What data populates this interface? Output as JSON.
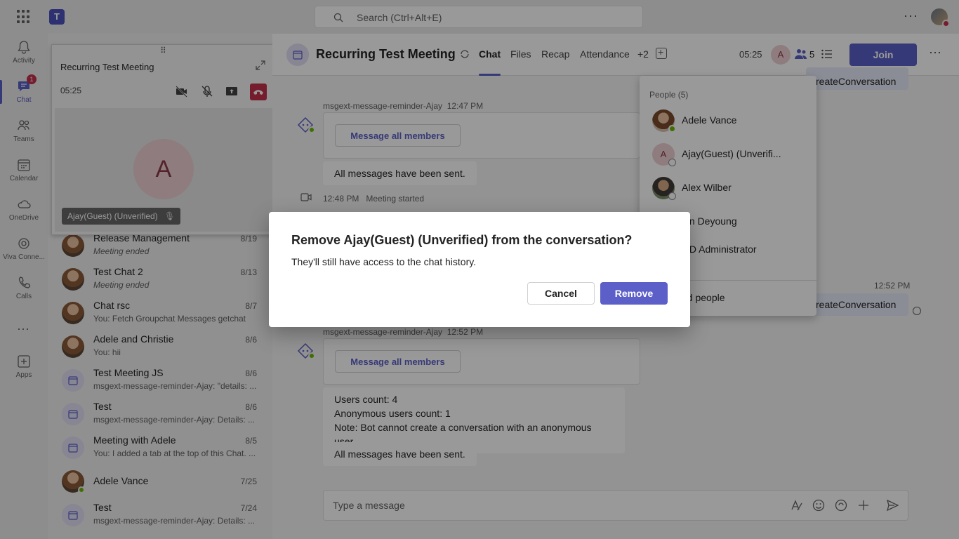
{
  "topbar": {
    "search_placeholder": "Search (Ctrl+Alt+E)",
    "app_logo": "T"
  },
  "rail": {
    "items": [
      {
        "label": "Activity",
        "icon": "bell-icon"
      },
      {
        "label": "Chat",
        "icon": "chat-icon",
        "badge": "1"
      },
      {
        "label": "Teams",
        "icon": "teams-icon"
      },
      {
        "label": "Calendar",
        "icon": "calendar-icon"
      },
      {
        "label": "OneDrive",
        "icon": "cloud-icon"
      },
      {
        "label": "Viva Conne...",
        "icon": "viva-icon"
      },
      {
        "label": "Calls",
        "icon": "phone-icon"
      },
      {
        "label": "Apps",
        "icon": "plus-square-icon"
      }
    ]
  },
  "mini_meeting": {
    "title": "Recurring Test Meeting",
    "time": "05:25",
    "avatar_letter": "A",
    "participant_label": "Ajay(Guest) (Unverified)"
  },
  "chats": [
    {
      "name": "Release Management",
      "date": "8/19",
      "preview": "Meeting ended"
    },
    {
      "name": "Test Chat 2",
      "date": "8/13",
      "preview": "Meeting ended"
    },
    {
      "name": "Chat rsc",
      "date": "8/7",
      "preview": "You: Fetch Groupchat Messages getchat"
    },
    {
      "name": "Adele and Christie",
      "date": "8/6",
      "preview": "You: hii"
    },
    {
      "name": "Test Meeting JS",
      "date": "8/6",
      "preview": "msgext-message-reminder-Ajay: \"details: ..."
    },
    {
      "name": "Test",
      "date": "8/6",
      "preview": "msgext-message-reminder-Ajay: Details: ..."
    },
    {
      "name": "Meeting with Adele",
      "date": "8/5",
      "preview": "You: I added a tab at the top of this Chat. ..."
    },
    {
      "name": "Adele Vance",
      "date": "7/25",
      "preview": ""
    },
    {
      "name": "Test",
      "date": "7/24",
      "preview": "msgext-message-reminder-Ajay: Details: ..."
    }
  ],
  "header": {
    "title": "Recurring Test Meeting",
    "tabs": [
      "Chat",
      "Files",
      "Recap",
      "Attendance",
      "+2"
    ],
    "time": "05:25",
    "avatar_letter": "A",
    "people_count": "5",
    "join_label": "Join"
  },
  "conversation": {
    "msg1": {
      "sender": "msgext-message-reminder-Ajay",
      "time": "12:47 PM",
      "button": "Message all members",
      "text": "All messages have been sent."
    },
    "event": {
      "time": "12:48 PM",
      "text": "Meeting started"
    },
    "right_top": "reateConversation",
    "right_time": "12:52 PM",
    "right_bottom": "reateConversation",
    "msg2": {
      "sender": "msgext-message-reminder-Ajay",
      "time": "12:52 PM",
      "button": "Message all members",
      "lines": [
        "Users count: 4",
        "Anonymous users count: 1",
        "Note: Bot cannot create a conversation with an anonymous user."
      ],
      "text": "All messages have been sent."
    },
    "composer_placeholder": "Type a message"
  },
  "people_panel": {
    "header": "People (5)",
    "people": [
      {
        "name": "Adele Vance",
        "sub": ""
      },
      {
        "name": "Ajay(Guest) (Unverifi...",
        "sub": "",
        "letter": "A"
      },
      {
        "name": "Alex Wilber",
        "sub": ""
      },
      {
        "name": "lan Deyoung",
        "sub": ""
      },
      {
        "name": "OD Administrator",
        "sub": "u"
      }
    ],
    "add_people": "dd people"
  },
  "dialog": {
    "title": "Remove Ajay(Guest) (Unverified) from the conversation?",
    "body": "They'll still have access to the chat history.",
    "cancel": "Cancel",
    "remove": "Remove"
  },
  "colors": {
    "accent": "#5b5fc7",
    "danger": "#c4314b",
    "online": "#6bb700"
  }
}
